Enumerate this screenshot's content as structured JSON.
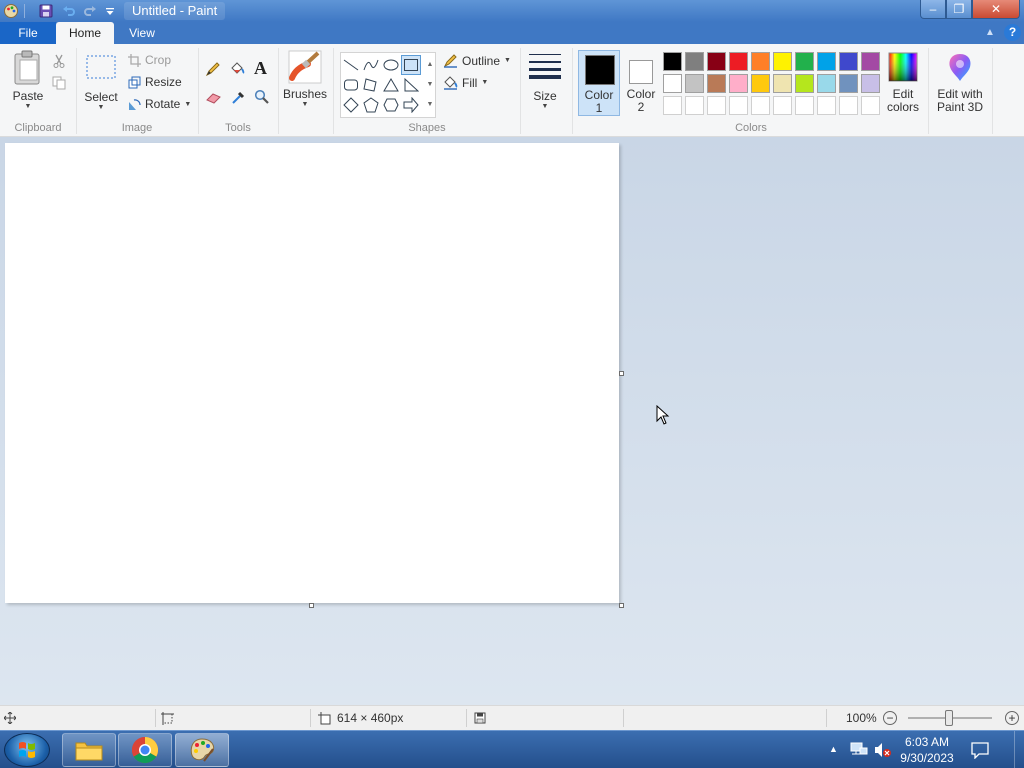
{
  "window": {
    "title": "Untitled - Paint",
    "controls": {
      "minimize": "–",
      "maximize": "❐",
      "close": "✕"
    },
    "help": "?"
  },
  "tabs": [
    "File",
    "Home",
    "View"
  ],
  "ribbon": {
    "clipboard": {
      "paste": "Paste",
      "group": "Clipboard"
    },
    "image": {
      "select": "Select",
      "crop": "Crop",
      "resize": "Resize",
      "rotate": "Rotate",
      "group": "Image"
    },
    "tools": {
      "group": "Tools"
    },
    "brushes": {
      "label": "Brushes"
    },
    "shapes": {
      "outline": "Outline",
      "fill": "Fill",
      "group": "Shapes"
    },
    "size": {
      "label": "Size"
    },
    "colors": {
      "color1_label": "Color\n1",
      "color1_line1": "Color",
      "color1_line2": "1",
      "color2_line1": "Color",
      "color2_line2": "2",
      "color1": "#000000",
      "color2": "#ffffff",
      "edit_colors_line1": "Edit",
      "edit_colors_line2": "colors",
      "paint3d_line1": "Edit with",
      "paint3d_line2": "Paint 3D",
      "group": "Colors",
      "palette_row1": [
        "#000000",
        "#7f7f7f",
        "#880015",
        "#ed1c24",
        "#ff7f27",
        "#fff200",
        "#22b14c",
        "#00a2e8",
        "#3f48cc",
        "#a349a4"
      ],
      "palette_row2": [
        "#ffffff",
        "#c3c3c3",
        "#b97a57",
        "#ffaec9",
        "#ffc90e",
        "#efe4b0",
        "#b5e61d",
        "#99d9ea",
        "#7092be",
        "#c8bfe7"
      ],
      "palette_row3": [
        "#ffffff",
        "#ffffff",
        "#ffffff",
        "#ffffff",
        "#ffffff",
        "#ffffff",
        "#ffffff",
        "#ffffff",
        "#ffffff",
        "#ffffff"
      ]
    }
  },
  "status": {
    "canvas_size": "614 × 460px",
    "zoom": "100%"
  },
  "taskbar": {
    "time": "6:03 AM",
    "date": "9/30/2023"
  }
}
